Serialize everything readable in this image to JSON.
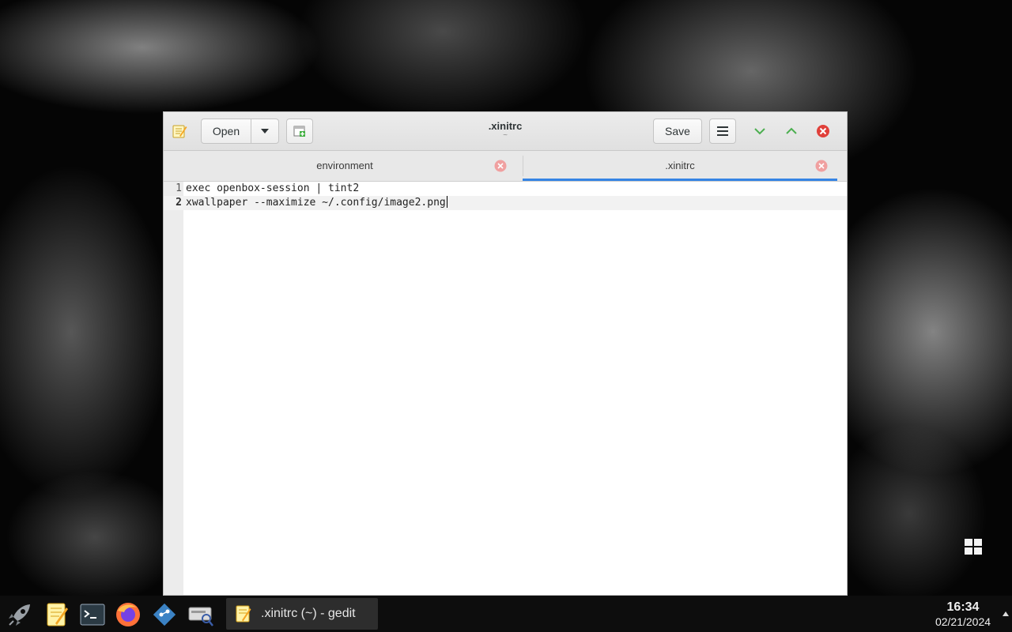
{
  "window": {
    "title": ".xinitrc",
    "subtitle": "~",
    "open_label": "Open",
    "save_label": "Save"
  },
  "tabs": [
    {
      "label": "environment",
      "active": false
    },
    {
      "label": ".xinitrc",
      "active": true
    }
  ],
  "editor": {
    "lines": [
      {
        "number": "1",
        "text": "exec openbox-session | tint2"
      },
      {
        "number": "2",
        "text": "xwallpaper --maximize ~/.config/image2.png"
      }
    ],
    "current_line": 2
  },
  "taskbar": {
    "launchers": [
      "launcher-icon",
      "gedit-icon",
      "terminal-icon",
      "firefox-icon",
      "git-icon",
      "search-icon"
    ],
    "task_label": ".xinitrc (~) - gedit",
    "time": "16:34",
    "date": "02/21/2024"
  },
  "colors": {
    "accent": "#3584e4",
    "close_red": "#e0403a",
    "wm_green": "#4caf50"
  }
}
